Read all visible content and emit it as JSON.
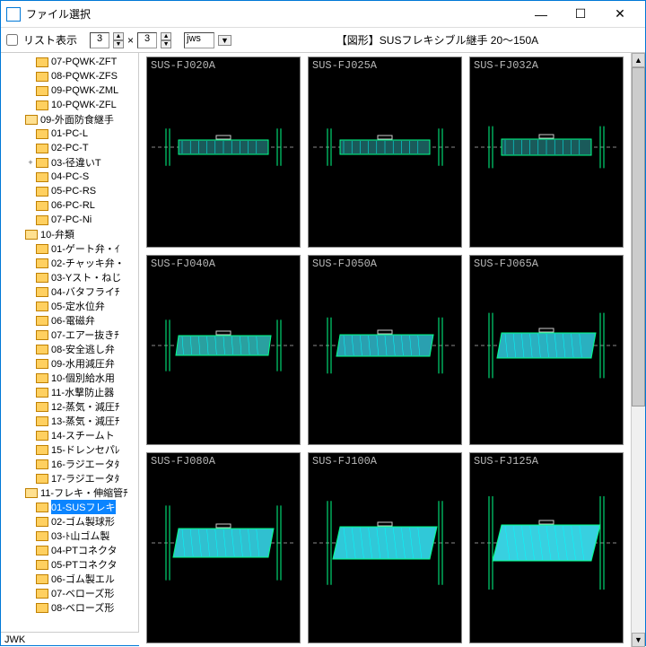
{
  "window": {
    "title": "ファイル選択",
    "min": "—",
    "max": "☐",
    "close": "✕"
  },
  "toolbar": {
    "list_label": "リスト表示",
    "num1": "3",
    "times": "×",
    "num2": "3",
    "ext": "jws",
    "ext_arrow": "▼"
  },
  "header": "【図形】SUSフレキシブル継手 20～150A",
  "tree": [
    {
      "d": 2,
      "e": "",
      "o": 0,
      "t": "07-PQWK-ZFT"
    },
    {
      "d": 2,
      "e": "",
      "o": 0,
      "t": "08-PQWK-ZFS"
    },
    {
      "d": 2,
      "e": "",
      "o": 0,
      "t": "09-PQWK-ZML"
    },
    {
      "d": 2,
      "e": "",
      "o": 0,
      "t": "10-PQWK-ZFL"
    },
    {
      "d": 1,
      "e": "",
      "o": 1,
      "t": "09-外面防食継手"
    },
    {
      "d": 2,
      "e": "",
      "o": 0,
      "t": "01-PC-L"
    },
    {
      "d": 2,
      "e": "",
      "o": 0,
      "t": "02-PC-T"
    },
    {
      "d": 2,
      "e": "+",
      "o": 0,
      "t": "03-径違いT"
    },
    {
      "d": 2,
      "e": "",
      "o": 0,
      "t": "04-PC-S"
    },
    {
      "d": 2,
      "e": "",
      "o": 0,
      "t": "05-PC-RS"
    },
    {
      "d": 2,
      "e": "",
      "o": 0,
      "t": "06-PC-RL"
    },
    {
      "d": 2,
      "e": "",
      "o": 0,
      "t": "07-PC-Ni"
    },
    {
      "d": 1,
      "e": "",
      "o": 1,
      "t": "10-弁類"
    },
    {
      "d": 2,
      "e": "",
      "o": 0,
      "t": "01-ゲート弁・ｲ"
    },
    {
      "d": 2,
      "e": "",
      "o": 0,
      "t": "02-チャッキ弁・"
    },
    {
      "d": 2,
      "e": "",
      "o": 0,
      "t": "03-Yスト・ねじ"
    },
    {
      "d": 2,
      "e": "",
      "o": 0,
      "t": "04-バタフライﾁ"
    },
    {
      "d": 2,
      "e": "",
      "o": 0,
      "t": "05-定水位弁"
    },
    {
      "d": 2,
      "e": "",
      "o": 0,
      "t": "06-電磁弁"
    },
    {
      "d": 2,
      "e": "",
      "o": 0,
      "t": "07-エアー抜きﾁ"
    },
    {
      "d": 2,
      "e": "",
      "o": 0,
      "t": "08-安全逃し弁"
    },
    {
      "d": 2,
      "e": "",
      "o": 0,
      "t": "09-水用減圧弁"
    },
    {
      "d": 2,
      "e": "",
      "o": 0,
      "t": "10-個別給水用"
    },
    {
      "d": 2,
      "e": "",
      "o": 0,
      "t": "11-水撃防止器"
    },
    {
      "d": 2,
      "e": "",
      "o": 0,
      "t": "12-蒸気・減圧ﾁ"
    },
    {
      "d": 2,
      "e": "",
      "o": 0,
      "t": "13-蒸気・減圧ﾁ"
    },
    {
      "d": 2,
      "e": "",
      "o": 0,
      "t": "14-スチームト"
    },
    {
      "d": 2,
      "e": "",
      "o": 0,
      "t": "15-ドレンセパﾚ"
    },
    {
      "d": 2,
      "e": "",
      "o": 0,
      "t": "16-ラジエータﾀ"
    },
    {
      "d": 2,
      "e": "",
      "o": 0,
      "t": "17-ラジエータﾀ"
    },
    {
      "d": 1,
      "e": "",
      "o": 1,
      "t": "11-フレキ・伸縮管ﾁ"
    },
    {
      "d": 2,
      "e": "",
      "o": 0,
      "t": "01-SUSフレキ",
      "sel": 1
    },
    {
      "d": 2,
      "e": "",
      "o": 0,
      "t": "02-ゴム製球形"
    },
    {
      "d": 2,
      "e": "",
      "o": 0,
      "t": "03-ﾄ山ゴム製"
    },
    {
      "d": 2,
      "e": "",
      "o": 0,
      "t": "04-PTコネクタ"
    },
    {
      "d": 2,
      "e": "",
      "o": 0,
      "t": "05-PTコネクタ"
    },
    {
      "d": 2,
      "e": "",
      "o": 0,
      "t": "06-ゴム製エル"
    },
    {
      "d": 2,
      "e": "",
      "o": 0,
      "t": "07-ベローズ形"
    },
    {
      "d": 2,
      "e": "",
      "o": 0,
      "t": "08-ベローズ形"
    }
  ],
  "status": "JWK",
  "thumbs": [
    {
      "label": "SUS-FJ020A",
      "h": 16,
      "skew": 0,
      "fill": "#1a5a5a"
    },
    {
      "label": "SUS-FJ025A",
      "h": 16,
      "skew": 0,
      "fill": "#1a5a5a"
    },
    {
      "label": "SUS-FJ032A",
      "h": 18,
      "skew": 0,
      "fill": "#1a5a5a"
    },
    {
      "label": "SUS-FJ040A",
      "h": 22,
      "skew": 3,
      "fill": "#2aa0a0"
    },
    {
      "label": "SUS-FJ050A",
      "h": 24,
      "skew": 4,
      "fill": "#2aa0b0"
    },
    {
      "label": "SUS-FJ065A",
      "h": 28,
      "skew": 5,
      "fill": "#2ab0c0"
    },
    {
      "label": "SUS-FJ080A",
      "h": 32,
      "skew": 6,
      "fill": "#30c0d0"
    },
    {
      "label": "SUS-FJ100A",
      "h": 36,
      "skew": 8,
      "fill": "#30c8d8"
    },
    {
      "label": "SUS-FJ125A",
      "h": 40,
      "skew": 10,
      "fill": "#38d0e0"
    }
  ]
}
